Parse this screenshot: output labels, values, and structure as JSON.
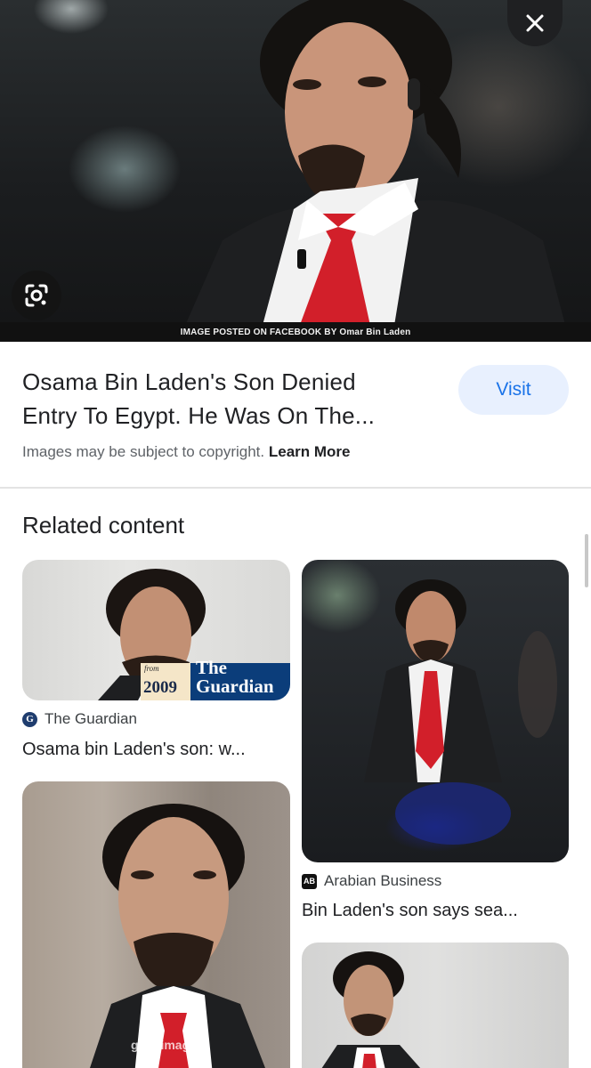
{
  "hero": {
    "caption": "IMAGE POSTED ON FACEBOOK BY Omar Bin Laden",
    "close_icon": "close-icon",
    "lens_icon": "google-lens-icon"
  },
  "result": {
    "title_line1": "Osama Bin Laden's Son Denied",
    "title_line2": "Entry To Egypt. He Was On The...",
    "visit_label": "Visit",
    "copyright_text": "Images may be subject to copyright.",
    "learn_more": "Learn More"
  },
  "related": {
    "heading": "Related content",
    "cards": [
      {
        "source": "The Guardian",
        "source_icon": "G",
        "title": "Osama bin Laden's son: w...",
        "badge_from": "from",
        "badge_year": "2009",
        "badge_brand": "The Guardian"
      },
      {
        "source": "Arabian Business",
        "source_icon": "AB",
        "title": "Bin Laden's son says sea..."
      },
      {
        "watermark": "gettyimages"
      }
    ]
  },
  "colors": {
    "accent": "#1a73e8",
    "visit_bg": "#e8f0fe",
    "text_primary": "#202124",
    "text_secondary": "#5f6368"
  }
}
